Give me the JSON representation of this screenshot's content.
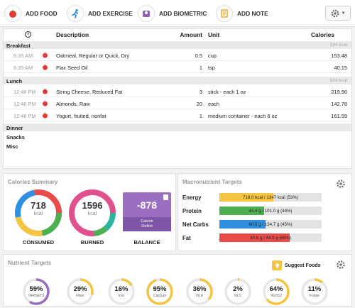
{
  "toolbar": {
    "add_food": "ADD FOOD",
    "add_exercise": "ADD EXERCISE",
    "add_biometric": "ADD BIOMETRIC",
    "add_note": "ADD NOTE"
  },
  "diary": {
    "headers": {
      "description": "Description",
      "amount": "Amount",
      "unit": "Unit",
      "calories": "Calories"
    },
    "breakfast": {
      "label": "Breakfast",
      "kcal": "194 kcal",
      "rows": [
        {
          "time": "6:35 AM",
          "desc": "Oatmeal, Regular or Quick, Dry",
          "amount": "0.5",
          "unit": "cup",
          "cal": "153.48"
        },
        {
          "time": "6:35 AM",
          "desc": "Flax Seed Oil",
          "amount": "1",
          "unit": "tsp",
          "cal": "40.15"
        }
      ]
    },
    "lunch": {
      "label": "Lunch",
      "kcal": "524 kcal",
      "rows": [
        {
          "time": "12:46 PM",
          "desc": "String Cheese, Reduced Fat",
          "amount": "3",
          "unit": "stick - each 1 oz",
          "cal": "219.96"
        },
        {
          "time": "12:46 PM",
          "desc": "Almonds, Raw",
          "amount": "20",
          "unit": "each",
          "cal": "142.78"
        },
        {
          "time": "12:46 PM",
          "desc": "Yogurt, fruited, nonfat",
          "amount": "1",
          "unit": "medium container - each 6 oz",
          "cal": "161.59"
        }
      ]
    },
    "dinner": "Dinner",
    "snacks": "Snacks",
    "misc": "Misc"
  },
  "calories_summary": {
    "title": "Calories Summary",
    "consumed_value": "718",
    "consumed_unit": "kcal",
    "consumed_label": "CONSUMED",
    "burned_value": "1596",
    "burned_unit": "kcal",
    "burned_label": "BURNED",
    "balance_value": "-878",
    "balance_sub_1": "Calorie",
    "balance_sub_2": "Deficit",
    "balance_label": "BALANCE"
  },
  "macro_targets": {
    "title": "Macronutrient Targets",
    "items": [
      {
        "name": "Energy",
        "text": "718.0 kcal / 1347 kcal (53%)",
        "pct": 53,
        "color": "#f4c542"
      },
      {
        "name": "Protein",
        "text": "44.4 g / 101.0 g (44%)",
        "pct": 44,
        "color": "#4caf50"
      },
      {
        "name": "Net Carbs",
        "text": "60.5 g / 134.7 g (45%)",
        "pct": 45,
        "color": "#2f8fe0"
      },
      {
        "name": "Fat",
        "text": "30.8 g / 44.9 g (69%)",
        "pct": 69,
        "color": "#e94b4b"
      }
    ]
  },
  "nutrient_targets": {
    "title": "Nutrient Targets",
    "suggest_label": "Suggest Foods",
    "items": [
      {
        "value": "59%",
        "label": "TARGETS",
        "pct": 59,
        "color": "#9a6fc0"
      },
      {
        "value": "29%",
        "label": "Fiber",
        "pct": 29,
        "color": "#f4c542"
      },
      {
        "value": "16%",
        "label": "Iron",
        "pct": 16,
        "color": "#f4c542"
      },
      {
        "value": "95%",
        "label": "Calcium",
        "pct": 95,
        "color": "#f4c542"
      },
      {
        "value": "36%",
        "label": "Vit.A",
        "pct": 36,
        "color": "#f4c542"
      },
      {
        "value": "2%",
        "label": "Vit.C",
        "pct": 2,
        "color": "#f4c542"
      },
      {
        "value": "64%",
        "label": "Vit.B12",
        "pct": 64,
        "color": "#f4c542"
      },
      {
        "value": "11%",
        "label": "Folate",
        "pct": 11,
        "color": "#f4c542"
      }
    ]
  }
}
